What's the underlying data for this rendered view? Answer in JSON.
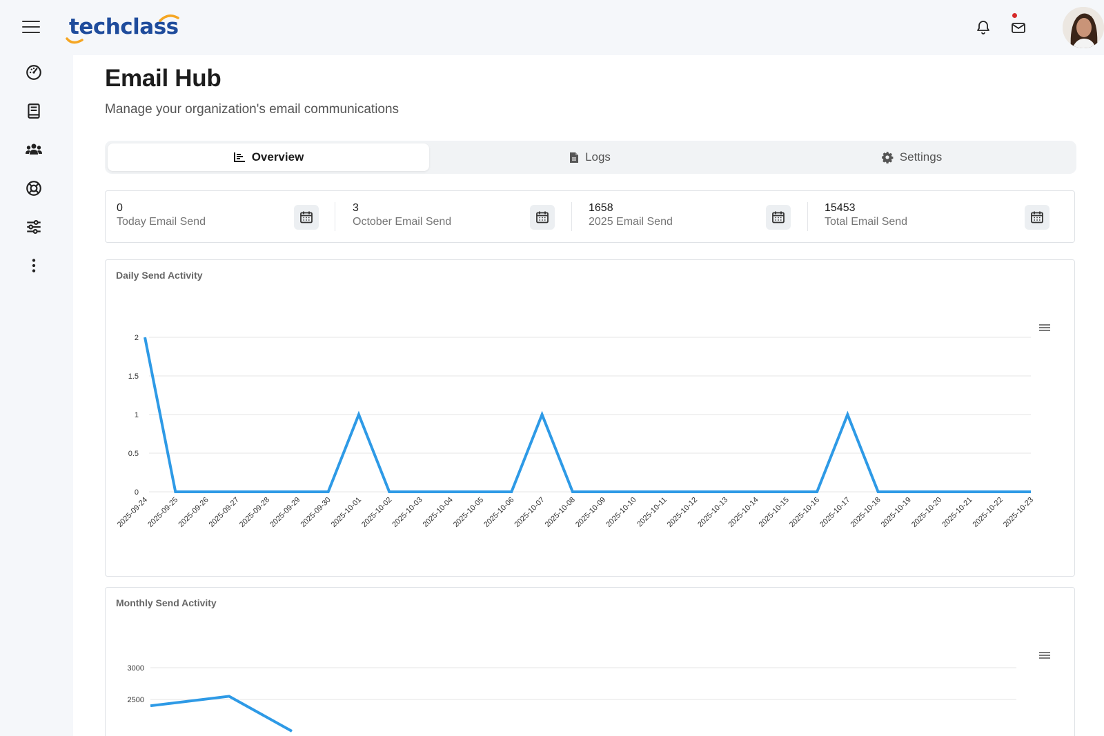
{
  "brand": {
    "name": "techclass",
    "accent": "#f5a623",
    "primary": "#1f4c9c"
  },
  "header": {
    "icons": [
      "menu-icon",
      "bell-icon",
      "mail-icon"
    ],
    "notification_dot_color": "#d62a2a"
  },
  "sidebar": {
    "items": [
      {
        "icon": "dashboard-gauge-icon"
      },
      {
        "icon": "book-icon"
      },
      {
        "icon": "users-icon"
      },
      {
        "icon": "lifebuoy-icon"
      },
      {
        "icon": "sliders-icon"
      },
      {
        "icon": "more-vertical-icon"
      }
    ]
  },
  "page": {
    "title": "Email Hub",
    "subtitle": "Manage your organization's email communications"
  },
  "tabs": [
    {
      "label": "Overview",
      "icon": "chart-bar-icon",
      "active": true
    },
    {
      "label": "Logs",
      "icon": "file-icon",
      "active": false
    },
    {
      "label": "Settings",
      "icon": "gear-icon",
      "active": false
    }
  ],
  "stats": [
    {
      "value": "0",
      "label": "Today Email Send",
      "icon": "calendar-icon"
    },
    {
      "value": "3",
      "label": "October Email Send",
      "icon": "calendar-icon"
    },
    {
      "value": "1658",
      "label": "2025 Email Send",
      "icon": "calendar-icon"
    },
    {
      "value": "15453",
      "label": "Total Email Send",
      "icon": "calendar-icon"
    }
  ],
  "chart_data": [
    {
      "type": "line",
      "title": "Daily Send Activity",
      "series_color": "#2e9ae6",
      "x": [
        "2025-09-24",
        "2025-09-25",
        "2025-09-26",
        "2025-09-27",
        "2025-09-28",
        "2025-09-29",
        "2025-09-30",
        "2025-10-01",
        "2025-10-02",
        "2025-10-03",
        "2025-10-04",
        "2025-10-05",
        "2025-10-06",
        "2025-10-07",
        "2025-10-08",
        "2025-10-09",
        "2025-10-10",
        "2025-10-11",
        "2025-10-12",
        "2025-10-13",
        "2025-10-14",
        "2025-10-15",
        "2025-10-16",
        "2025-10-17",
        "2025-10-18",
        "2025-10-19",
        "2025-10-20",
        "2025-10-21",
        "2025-10-22",
        "2025-10-23"
      ],
      "values": [
        2,
        0,
        0,
        0,
        0,
        0,
        0,
        1,
        0,
        0,
        0,
        0,
        0,
        1,
        0,
        0,
        0,
        0,
        0,
        0,
        0,
        0,
        0,
        1,
        0,
        0,
        0,
        0,
        0,
        0
      ],
      "yticks": [
        "0",
        "0.5",
        "1",
        "1.5",
        "2"
      ],
      "ylim": [
        0,
        2
      ],
      "grid": true
    },
    {
      "type": "line",
      "title": "Monthly Send Activity",
      "series_color": "#2e9ae6",
      "values_visible": [
        2400,
        2550,
        2000
      ],
      "yticks": [
        "2500",
        "3000"
      ],
      "ylim": [
        2000,
        3000
      ],
      "grid": true
    }
  ]
}
